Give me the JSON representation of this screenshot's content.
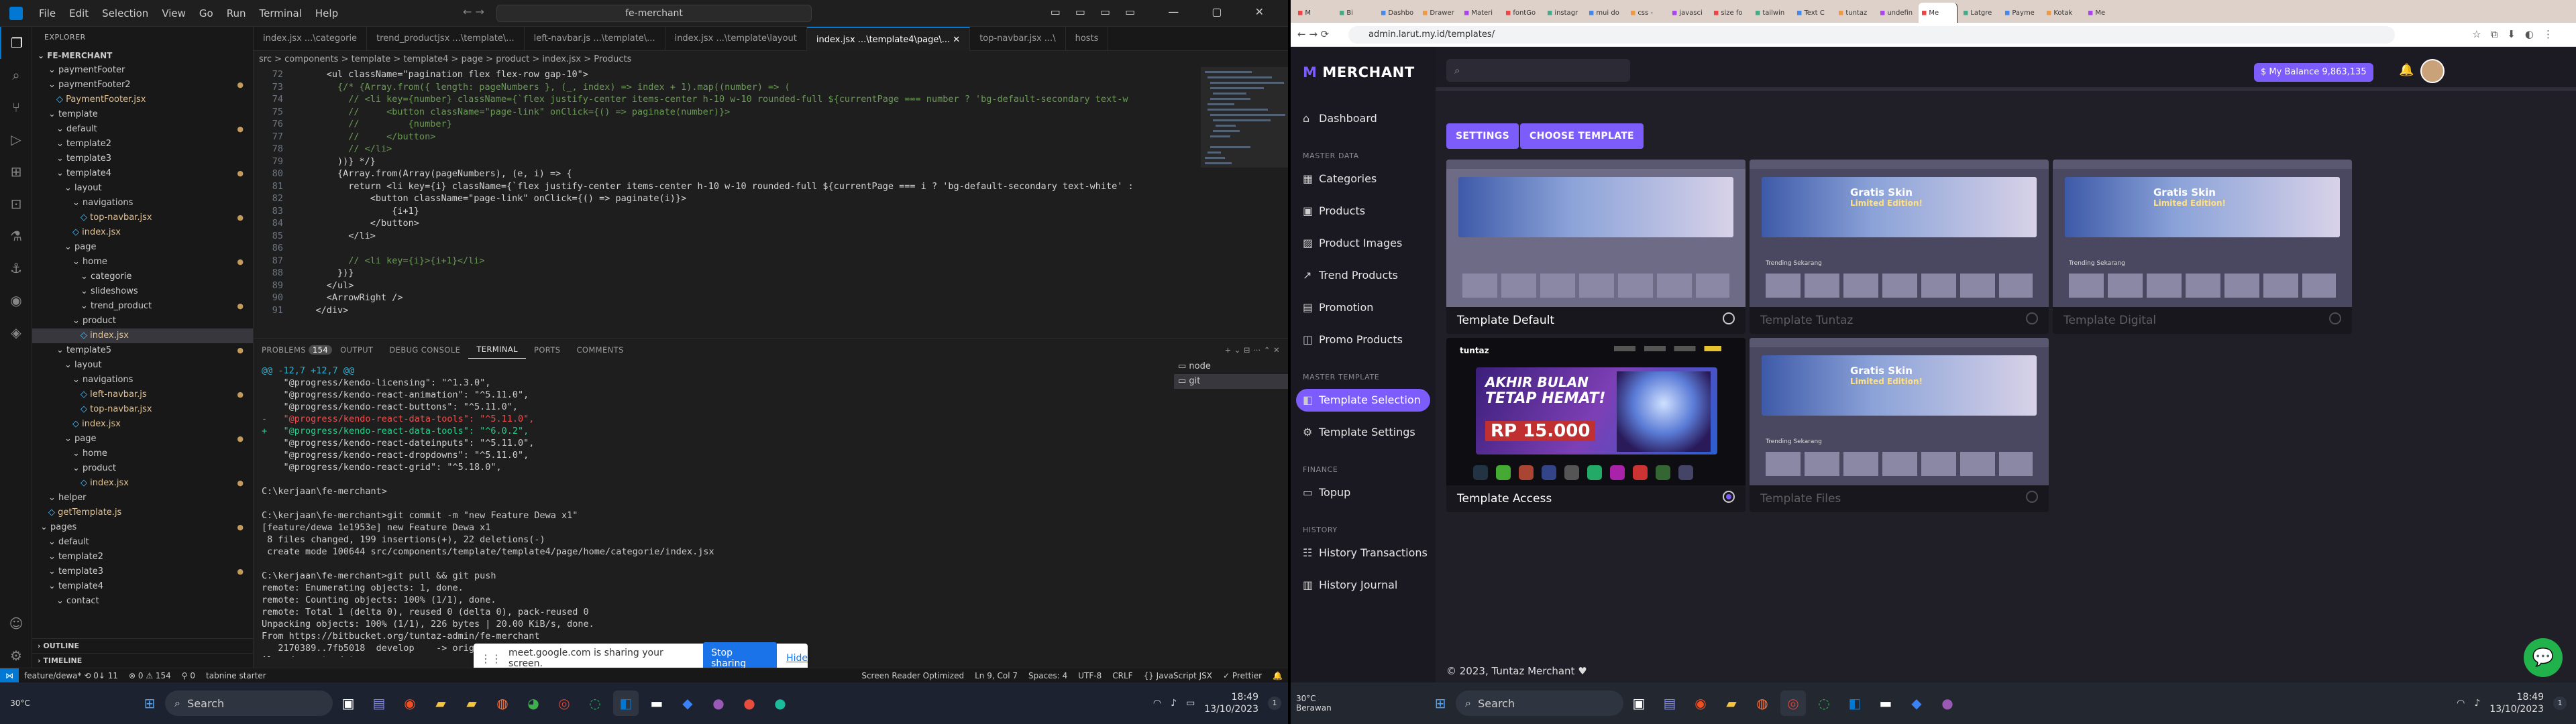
{
  "vscode": {
    "menu": [
      "File",
      "Edit",
      "Selection",
      "View",
      "Go",
      "Run",
      "Terminal",
      "Help"
    ],
    "search": "fe-merchant",
    "explorer_title": "EXPLORER",
    "project": "FE-MERCHANT",
    "tree": [
      {
        "label": "paymentFooter",
        "depth": 1,
        "kind": "folder"
      },
      {
        "label": "paymentFooter2",
        "depth": 1,
        "kind": "folder"
      },
      {
        "label": "PaymentFooter.jsx",
        "depth": 2,
        "kind": "file"
      },
      {
        "label": "template",
        "depth": 1,
        "kind": "folder"
      },
      {
        "label": "default",
        "depth": 2,
        "kind": "folder"
      },
      {
        "label": "template2",
        "depth": 2,
        "kind": "folder"
      },
      {
        "label": "template3",
        "depth": 2,
        "kind": "folder"
      },
      {
        "label": "template4",
        "depth": 2,
        "kind": "folder"
      },
      {
        "label": "layout",
        "depth": 3,
        "kind": "folder"
      },
      {
        "label": "navigations",
        "depth": 4,
        "kind": "folder"
      },
      {
        "label": "top-navbar.jsx",
        "depth": 5,
        "kind": "file"
      },
      {
        "label": "index.jsx",
        "depth": 4,
        "kind": "file"
      },
      {
        "label": "page",
        "depth": 3,
        "kind": "folder"
      },
      {
        "label": "home",
        "depth": 4,
        "kind": "folder"
      },
      {
        "label": "categorie",
        "depth": 5,
        "kind": "folder"
      },
      {
        "label": "slideshows",
        "depth": 5,
        "kind": "folder"
      },
      {
        "label": "trend_product",
        "depth": 5,
        "kind": "folder"
      },
      {
        "label": "product",
        "depth": 4,
        "kind": "folder"
      },
      {
        "label": "index.jsx",
        "depth": 5,
        "kind": "file",
        "active": true
      },
      {
        "label": "template5",
        "depth": 2,
        "kind": "folder"
      },
      {
        "label": "layout",
        "depth": 3,
        "kind": "folder"
      },
      {
        "label": "navigations",
        "depth": 4,
        "kind": "folder"
      },
      {
        "label": "left-navbar.js",
        "depth": 5,
        "kind": "file"
      },
      {
        "label": "top-navbar.jsx",
        "depth": 5,
        "kind": "file"
      },
      {
        "label": "index.jsx",
        "depth": 4,
        "kind": "file"
      },
      {
        "label": "page",
        "depth": 3,
        "kind": "folder"
      },
      {
        "label": "home",
        "depth": 4,
        "kind": "folder"
      },
      {
        "label": "product",
        "depth": 4,
        "kind": "folder"
      },
      {
        "label": "index.jsx",
        "depth": 5,
        "kind": "file"
      },
      {
        "label": "helper",
        "depth": 1,
        "kind": "folder"
      },
      {
        "label": "getTemplate.js",
        "depth": 1,
        "kind": "file"
      },
      {
        "label": "pages",
        "depth": 0,
        "kind": "folder"
      },
      {
        "label": "default",
        "depth": 1,
        "kind": "folder"
      },
      {
        "label": "template2",
        "depth": 1,
        "kind": "folder"
      },
      {
        "label": "template3",
        "depth": 1,
        "kind": "folder"
      },
      {
        "label": "template4",
        "depth": 1,
        "kind": "folder"
      },
      {
        "label": "contact",
        "depth": 2,
        "kind": "folder"
      }
    ],
    "outline": "OUTLINE",
    "timeline": "TIMELINE",
    "tabs": [
      "index.jsx ...\\categorie",
      "trend_productjsx ...\\template\\...",
      "left-navbar.js ...\\template\\...",
      "index.jsx ...\\template\\layout",
      "index.jsx ...\\template4\\page\\...",
      "top-navbar.jsx ...\\",
      "hosts"
    ],
    "breadcrumb": "src > components > template > template4 > page > product > index.jsx > Products",
    "code_lines": [
      {
        "n": "72",
        "t": "      <ul className=\"pagination flex flex-row gap-10\">"
      },
      {
        "n": "73",
        "t": "        {/* {Array.from({ length: pageNumbers }, (_, index) => index + 1).map((number) => ("
      },
      {
        "n": "74",
        "t": "          // <li key={number} className={`flex justify-center items-center h-10 w-10 rounded-full ${currentPage === number ? 'bg-default-secondary text-w"
      },
      {
        "n": "75",
        "t": "          //     <button className=\"page-link\" onClick={() => paginate(number)}>"
      },
      {
        "n": "76",
        "t": "          //         {number}"
      },
      {
        "n": "77",
        "t": "          //     </button>"
      },
      {
        "n": "78",
        "t": "          // </li>"
      },
      {
        "n": "79",
        "t": "        ))} */}"
      },
      {
        "n": "80",
        "t": "        {Array.from(Array(pageNumbers), (e, i) => {"
      },
      {
        "n": "81",
        "t": "          return <li key={i} className={`flex justify-center items-center h-10 w-10 rounded-full ${currentPage === i ? 'bg-default-secondary text-white' :"
      },
      {
        "n": "82",
        "t": "              <button className=\"page-link\" onClick={() => paginate(i)}>"
      },
      {
        "n": "83",
        "t": "                  {i+1}"
      },
      {
        "n": "84",
        "t": "              </button>"
      },
      {
        "n": "85",
        "t": "          </li>"
      },
      {
        "n": "86",
        "t": ""
      },
      {
        "n": "87",
        "t": "          // <li key={i}>{i+1}</li>"
      },
      {
        "n": "88",
        "t": "        })}"
      },
      {
        "n": "89",
        "t": "      </ul>"
      },
      {
        "n": "90",
        "t": "      <ArrowRight />"
      },
      {
        "n": "91",
        "t": "    </div>"
      }
    ],
    "panel_tabs": [
      "PROBLEMS",
      "OUTPUT",
      "DEBUG CONSOLE",
      "TERMINAL",
      "PORTS",
      "COMMENTS"
    ],
    "problems_count": "154",
    "terminal_list": [
      "node",
      "git"
    ],
    "terminal": [
      "@@ -12,7 +12,7 @@",
      "    \"@progress/kendo-licensing\": \"^1.3.0\",",
      "    \"@progress/kendo-react-animation\": \"^5.11.0\",",
      "    \"@progress/kendo-react-buttons\": \"^5.11.0\",",
      "-   \"@progress/kendo-react-data-tools\": \"^5.11.0\",",
      "+   \"@progress/kendo-react-data-tools\": \"^6.0.2\",",
      "    \"@progress/kendo-react-dateinputs\": \"^5.11.0\",",
      "    \"@progress/kendo-react-dropdowns\": \"^5.11.0\",",
      "    \"@progress/kendo-react-grid\": \"^5.18.0\",",
      "",
      "C:\\kerjaan\\fe-merchant>",
      "",
      "C:\\kerjaan\\fe-merchant>git commit -m \"new Feature Dewa x1\"",
      "[feature/dewa 1e1953e] new Feature Dewa x1",
      " 8 files changed, 199 insertions(+), 22 deletions(-)",
      " create mode 100644 src/components/template/template4/page/home/categorie/index.jsx",
      "",
      "C:\\kerjaan\\fe-merchant>git pull && git push",
      "remote: Enumerating objects: 1, done.",
      "remote: Counting objects: 100% (1/1), done.",
      "remote: Total 1 (delta 0), reused 0 (delta 0), pack-reused 0",
      "Unpacking objects: 100% (1/1), 226 bytes | 20.00 KiB/s, done.",
      "From https://bitbucket.org/tuntaz-admin/fe-merchant",
      "   2170389..7fb5018  develop    -> origin/develop",
      "Already up to date."
    ],
    "share_bar": {
      "text": "meet.google.com is sharing your screen.",
      "stop": "Stop sharing",
      "hide": "Hide"
    },
    "status": {
      "branch": "feature/dewa* ⟲ 0↓ 11",
      "problems": "⊗ 0 ⚠ 154",
      "ports": "⚲ 0",
      "tabnine": "tabnine starter",
      "screen_reader": "Screen Reader Optimized",
      "position": "Ln 9, Col 7",
      "spaces": "Spaces: 4",
      "encoding": "UTF-8",
      "eol": "CRLF",
      "lang": "{} JavaScript JSX",
      "prettier": "✓ Prettier"
    }
  },
  "taskbar_left": {
    "weather_temp": "30°C",
    "search": "Search",
    "time": "18:49",
    "date": "13/10/2023",
    "notif": "1"
  },
  "taskbar_right": {
    "weather_temp": "30°C",
    "weather_desc": "Berawan",
    "search": "Search",
    "time": "18:49",
    "date": "13/10/2023",
    "notif": "1"
  },
  "browser": {
    "tabs": [
      "M",
      "Bi",
      "Dashbo",
      "Drawer",
      "Materi",
      "fontGo",
      "instagr",
      "mui do",
      "css -",
      "javasci",
      "size fo",
      "tailwin",
      "Text C",
      "tuntaz",
      "undefin",
      "Me",
      "Latgre",
      "Payme",
      "Kotak",
      "Me"
    ],
    "active_tab_index": 15,
    "url": "admin.larut.my.id/templates/"
  },
  "app": {
    "brand": "MERCHANT",
    "search_placeholder": "",
    "balance": "My Balance 9,863,135",
    "sections": [
      {
        "title": "",
        "items": [
          {
            "label": "Dashboard",
            "icon": "⌂"
          }
        ]
      },
      {
        "title": "MASTER DATA",
        "items": [
          {
            "label": "Categories",
            "icon": "▦"
          },
          {
            "label": "Products",
            "icon": "▣"
          },
          {
            "label": "Product Images",
            "icon": "▨"
          },
          {
            "label": "Trend Products",
            "icon": "↗"
          },
          {
            "label": "Promotion",
            "icon": "▤"
          },
          {
            "label": "Promo Products",
            "icon": "◫"
          }
        ]
      },
      {
        "title": "MASTER TEMPLATE",
        "items": [
          {
            "label": "Template Selection",
            "icon": "◧",
            "selected": true
          },
          {
            "label": "Template Settings",
            "icon": "⚙"
          }
        ]
      },
      {
        "title": "FINANCE",
        "items": [
          {
            "label": "Topup",
            "icon": "▭"
          }
        ]
      },
      {
        "title": "HISTORY",
        "items": [
          {
            "label": "History Transactions",
            "icon": "☷"
          },
          {
            "label": "History Journal",
            "icon": "▥"
          }
        ]
      }
    ],
    "buttons": {
      "settings": "SETTINGS",
      "choose": "CHOOSE TEMPLATE"
    },
    "cards": [
      {
        "title": "Template Default",
        "selected": false,
        "dim": false
      },
      {
        "title": "Template Tuntaz",
        "selected": false,
        "dim": true
      },
      {
        "title": "Template Digital",
        "selected": false,
        "dim": true
      },
      {
        "title": "Template Access",
        "selected": true,
        "dim": false
      },
      {
        "title": "Template Files",
        "selected": false,
        "dim": true
      }
    ],
    "banner": {
      "brand": "tuntaz",
      "line1": "AKHIR BULAN",
      "line2": "TETAP HEMAT!",
      "price": "RP 15.000"
    },
    "thumb_text": {
      "gratis": "Gratis Skin",
      "limited": "Limited Edition!",
      "trending": "Trending Sekarang"
    },
    "footer": "© 2023, Tuntaz Merchant ♥"
  },
  "colors": {
    "accent": "#7c5cfa",
    "vscode_bg": "#1e1e1e",
    "app_bg": "#201e27"
  }
}
